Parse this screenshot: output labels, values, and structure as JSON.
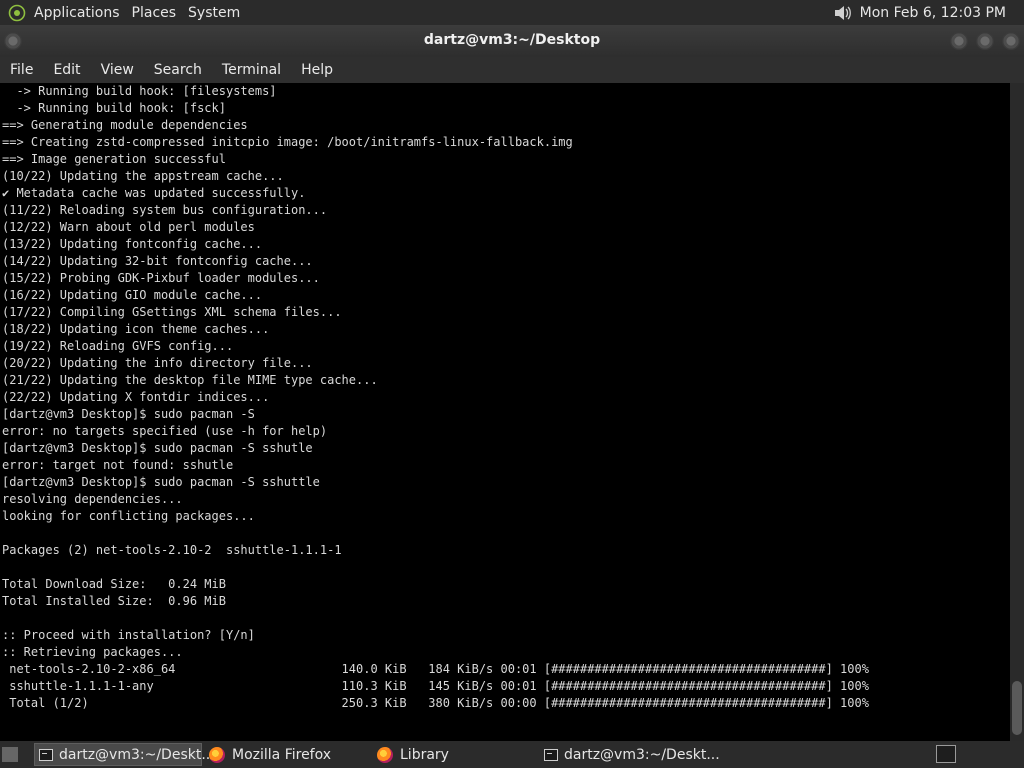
{
  "top_panel": {
    "menus": [
      "Applications",
      "Places",
      "System"
    ],
    "clock": "Mon Feb  6, 12:03 PM"
  },
  "window": {
    "title": "dartz@vm3:~/Desktop",
    "menubar": [
      "File",
      "Edit",
      "View",
      "Search",
      "Terminal",
      "Help"
    ]
  },
  "terminal": {
    "lines": [
      "  -> Running build hook: [filesystems]",
      "  -> Running build hook: [fsck]",
      "==> Generating module dependencies",
      "==> Creating zstd-compressed initcpio image: /boot/initramfs-linux-fallback.img",
      "==> Image generation successful",
      "(10/22) Updating the appstream cache...",
      "✔ Metadata cache was updated successfully.",
      "(11/22) Reloading system bus configuration...",
      "(12/22) Warn about old perl modules",
      "(13/22) Updating fontconfig cache...",
      "(14/22) Updating 32-bit fontconfig cache...",
      "(15/22) Probing GDK-Pixbuf loader modules...",
      "(16/22) Updating GIO module cache...",
      "(17/22) Compiling GSettings XML schema files...",
      "(18/22) Updating icon theme caches...",
      "(19/22) Reloading GVFS config...",
      "(20/22) Updating the info directory file...",
      "(21/22) Updating the desktop file MIME type cache...",
      "(22/22) Updating X fontdir indices...",
      "[dartz@vm3 Desktop]$ sudo pacman -S",
      "error: no targets specified (use -h for help)",
      "[dartz@vm3 Desktop]$ sudo pacman -S sshutle",
      "error: target not found: sshutle",
      "[dartz@vm3 Desktop]$ sudo pacman -S sshuttle",
      "resolving dependencies...",
      "looking for conflicting packages...",
      "",
      "Packages (2) net-tools-2.10-2  sshuttle-1.1.1-1",
      "",
      "Total Download Size:   0.24 MiB",
      "Total Installed Size:  0.96 MiB",
      "",
      ":: Proceed with installation? [Y/n]",
      ":: Retrieving packages...",
      " net-tools-2.10-2-x86_64                       140.0 KiB   184 KiB/s 00:01 [######################################] 100%",
      " sshuttle-1.1.1-1-any                          110.3 KiB   145 KiB/s 00:01 [######################################] 100%",
      " Total (1/2)                                   250.3 KiB   380 KiB/s 00:00 [######################################] 100%"
    ]
  },
  "taskbar": {
    "tasks": [
      {
        "label": "dartz@vm3:~/Deskt...",
        "icon": "terminal-icon",
        "active": true
      },
      {
        "label": "Mozilla Firefox",
        "icon": "firefox-icon",
        "active": false
      },
      {
        "label": "Library",
        "icon": "firefox-icon",
        "active": false
      },
      {
        "label": "dartz@vm3:~/Deskt...",
        "icon": "terminal-icon",
        "active": false
      }
    ]
  }
}
